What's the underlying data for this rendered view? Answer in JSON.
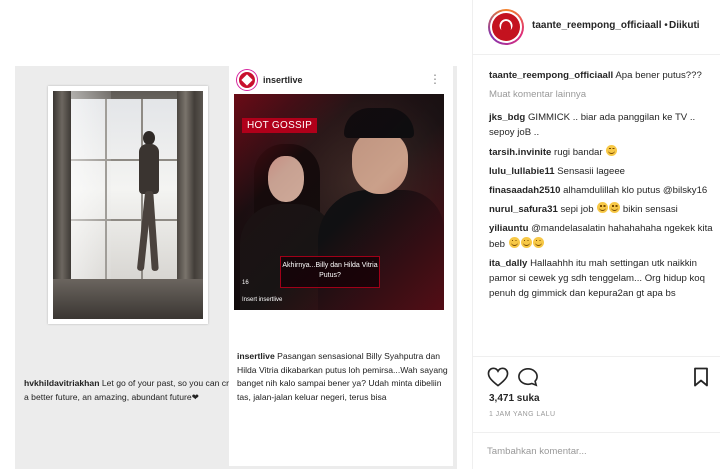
{
  "post": {
    "left_caption": {
      "username": "hvkhildavitriakhan",
      "text": "Let go of your past, so you can create a better future, an amazing, abundant future❤"
    },
    "embed": {
      "username": "insertlive",
      "more_label": "⋮",
      "badge": "HOT GOSSIP",
      "overlay_caption": "Akhirnya...Billy dan Hilda Vitria Putus?",
      "episode_number": "16",
      "watermark": "Insert  insertlive",
      "caption_username": "insertlive",
      "caption_text": "Pasangan sensasional Billy Syahputra dan Hilda Vitria dikabarkan putus loh pemirsa...Wah sayang banget nih kalo sampai bener ya? Udah minta dibeliin tas, jalan-jalan keluar negeri, terus bisa"
    }
  },
  "sidebar": {
    "header": {
      "username": "taante_reempong_officiaall",
      "separator": "•",
      "follow_label": "Diikuti"
    },
    "caption": {
      "username": "taante_reempong_officiaall",
      "text": "Apa bener putus???"
    },
    "load_more_label": "Muat komentar lainnya",
    "comments": [
      {
        "user": "jks_bdg",
        "text": "GIMMICK .. biar ada panggilan ke TV .. sepoy joB .."
      },
      {
        "user": "tarsih.invinite",
        "text": "rugi bandar"
      },
      {
        "user": "lulu_lullabie11",
        "text": "Sensasii lageee"
      },
      {
        "user": "finasaadah2510",
        "text": "alhamdulillah klo putus @bilsky16"
      },
      {
        "user": "nurul_safura31",
        "text": "sepi job",
        "text2": "bikin sensasi"
      },
      {
        "user": "yiliauntu",
        "text": "@mandelasalatin hahahahaha ngekek kita beb"
      },
      {
        "user": "ita_dally",
        "text": "Hallaahhh itu mah settingan utk naikkin pamor si cewek yg sdh tenggelam... Org hidup koq penuh dg gimmick dan kepura2an gt apa bs"
      }
    ],
    "likes": "3,471 suka",
    "timestamp": "1 JAM YANG LALU",
    "comment_placeholder": "Tambahkan komentar..."
  },
  "icons": {
    "heart": "heart-icon",
    "comment": "comment-icon",
    "bookmark": "bookmark-icon",
    "emoji": "laughing-emoji"
  },
  "colors": {
    "brand_red": "#b0001a",
    "text": "#262626",
    "muted": "#999999",
    "border": "#efefef"
  }
}
